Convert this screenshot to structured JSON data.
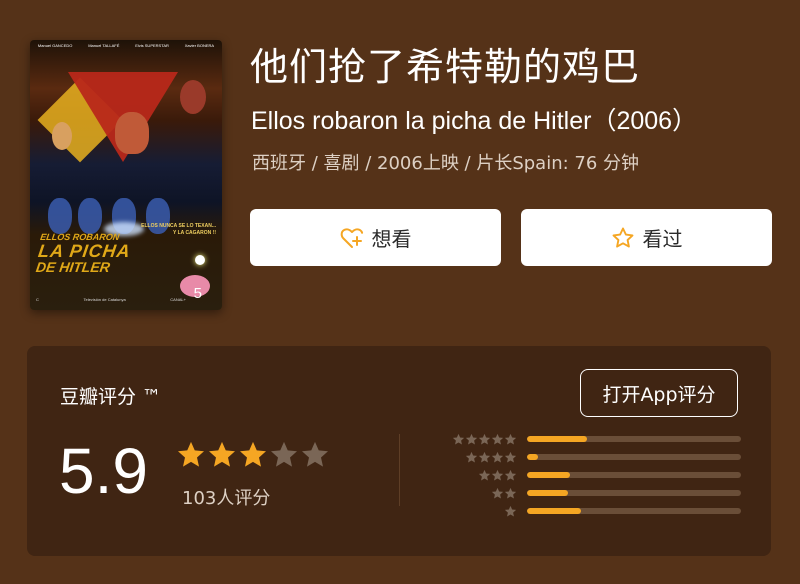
{
  "movie": {
    "title_cn": "他们抢了希特勒的鸡巴",
    "title_original": "Ellos robaron la picha de Hitler（2006）",
    "meta": "西班牙 / 喜剧 / 2006上映 / 片长Spain: 76 分钟"
  },
  "poster": {
    "credits": [
      "Manuel GANCEDO",
      "Manuel TALLAFÉ",
      "Elvis SUPERSTAR",
      "Xavier BONERA"
    ],
    "tagline_1": "ELLOS NUNCA SE LO TEXAN...",
    "tagline_2": "Y LA CAGARON !!",
    "title_line1": "ELLOS ROBARON",
    "title_line2": "LA PICHA",
    "title_line3": "DE HITLER",
    "logos": [
      "C",
      "Televisión de Catalunya",
      "CANAL+"
    ],
    "number": "5"
  },
  "actions": {
    "want_label": "想看",
    "want_icon": "heart-plus-icon",
    "seen_label": "看过",
    "seen_icon": "star-outline-icon"
  },
  "rating": {
    "brand": "豆瓣评分 ™",
    "open_app_label": "打开App评分",
    "score": "5.9",
    "stars_filled": 3,
    "stars_total": 5,
    "count_text": "103人评分",
    "accent": "#f5a623",
    "distribution": [
      {
        "stars": 5,
        "fraction": 0.28
      },
      {
        "stars": 4,
        "fraction": 0.05
      },
      {
        "stars": 3,
        "fraction": 0.2
      },
      {
        "stars": 2,
        "fraction": 0.19
      },
      {
        "stars": 1,
        "fraction": 0.25
      }
    ]
  }
}
